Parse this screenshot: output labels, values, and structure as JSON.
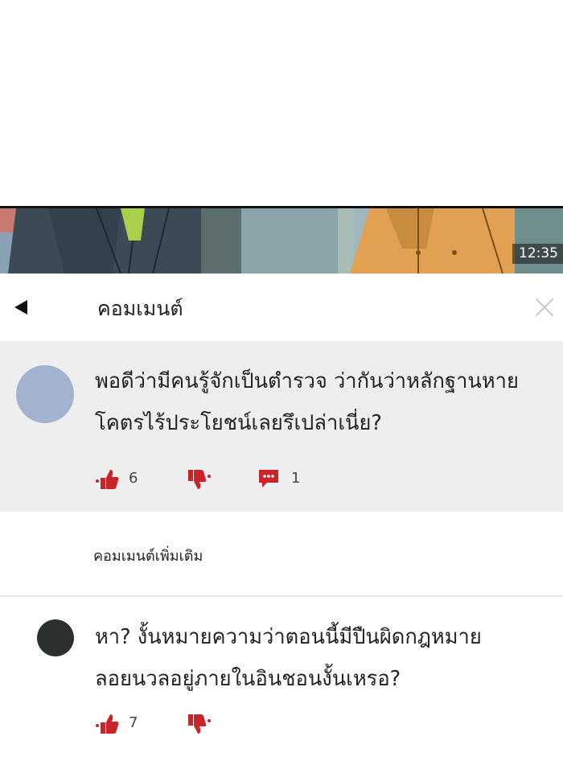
{
  "scene": {
    "timestamp": "12:35"
  },
  "header": {
    "back_icon": "back-arrow-icon",
    "title": "คอมเมนต์",
    "close_icon": "close-icon"
  },
  "comments": [
    {
      "text": "พอดีว่ามีคนรู้จักเป็นตำรวจ ว่ากันว่าหลักฐานหาย โคตรไร้ประโยชน์เลยรึเปล่าเนี่ย?",
      "likes": "6",
      "replies": "1",
      "avatar_color": "#a3b3cf"
    },
    {
      "text": "หา? งั้นหมายความว่าตอนนี้มีปืนผิดกฎหมายลอยนวลอยู่ภายในอินชอนงั้นเหรอ?",
      "likes": "7",
      "avatar_color": "#2c2f2f"
    }
  ],
  "more_comments_label": "คอมเมนต์เพิ่มเติม",
  "colors": {
    "icon_red": "#c8242a",
    "comment_bg": "#eeeeee"
  }
}
